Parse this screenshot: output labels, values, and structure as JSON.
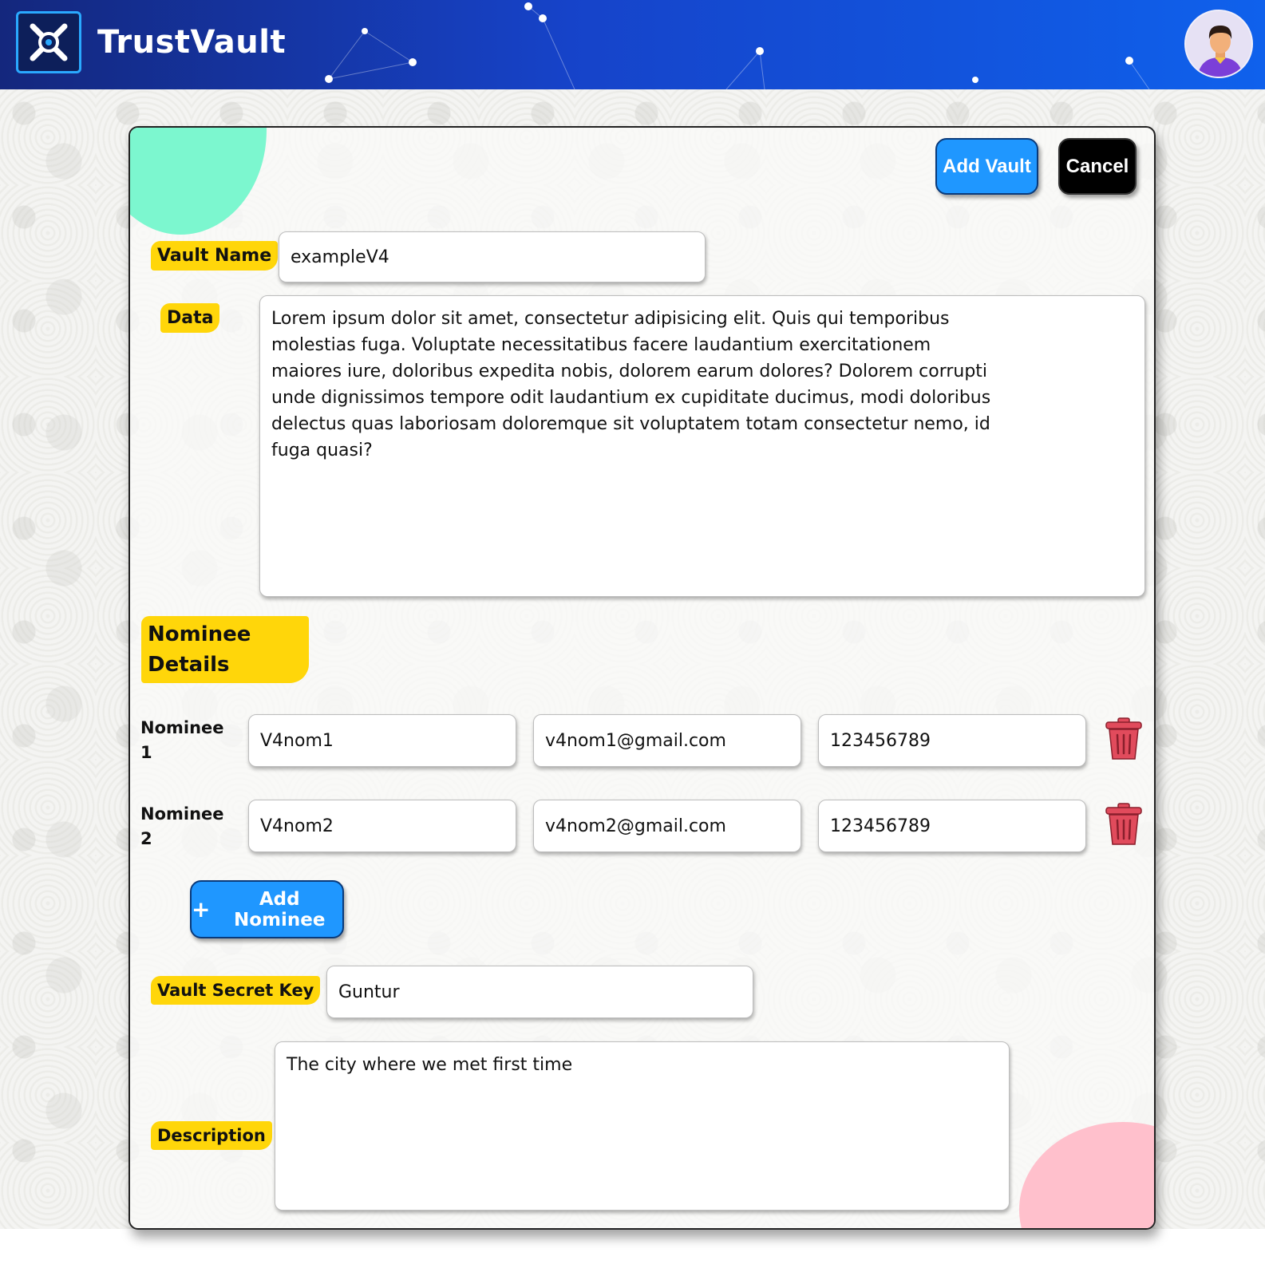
{
  "header": {
    "brand": "TrustVault",
    "logo_icon": "vault-x-icon",
    "avatar_icon": "user-avatar-icon",
    "colors": {
      "gradient_start": "#14277d",
      "gradient_end": "#0f61ec"
    }
  },
  "form": {
    "add_vault_label": "Add Vault",
    "cancel_label": "Cancel",
    "vault_name_label": "Vault Name",
    "vault_name_value": "exampleV4",
    "data_label": "Data",
    "data_value": "Lorem ipsum dolor sit amet, consectetur adipisicing elit. Quis qui temporibus molestias fuga. Voluptate necessitatibus facere laudantium exercitationem maiores iure, doloribus expedita nobis, dolorem earum dolores? Dolorem corrupti unde dignissimos tempore odit laudantium ex cupiditate ducimus, modi doloribus delectus quas laboriosam doloremque sit voluptatem totam consectetur nemo, id fuga quasi?",
    "nominee_section_title": "Nominee Details",
    "nominees": [
      {
        "label": "Nominee 1",
        "name": "V4nom1",
        "email": "v4nom1@gmail.com",
        "phone": "123456789"
      },
      {
        "label": "Nominee 2",
        "name": "V4nom2",
        "email": "v4nom2@gmail.com",
        "phone": "123456789"
      }
    ],
    "add_nominee_label": "Add Nominee",
    "secret_key_label": "Vault Secret Key",
    "secret_key_value": "Guntur",
    "description_label": "Description",
    "description_value": "The city where we met first time"
  },
  "colors": {
    "primary_button": "#1f97ff",
    "cancel_button": "#000000",
    "label_highlight": "#ffd60a",
    "deco_mint": "#7cf7cf",
    "deco_pink": "#ffc0cc",
    "trash_icon": "#e14b5c"
  }
}
